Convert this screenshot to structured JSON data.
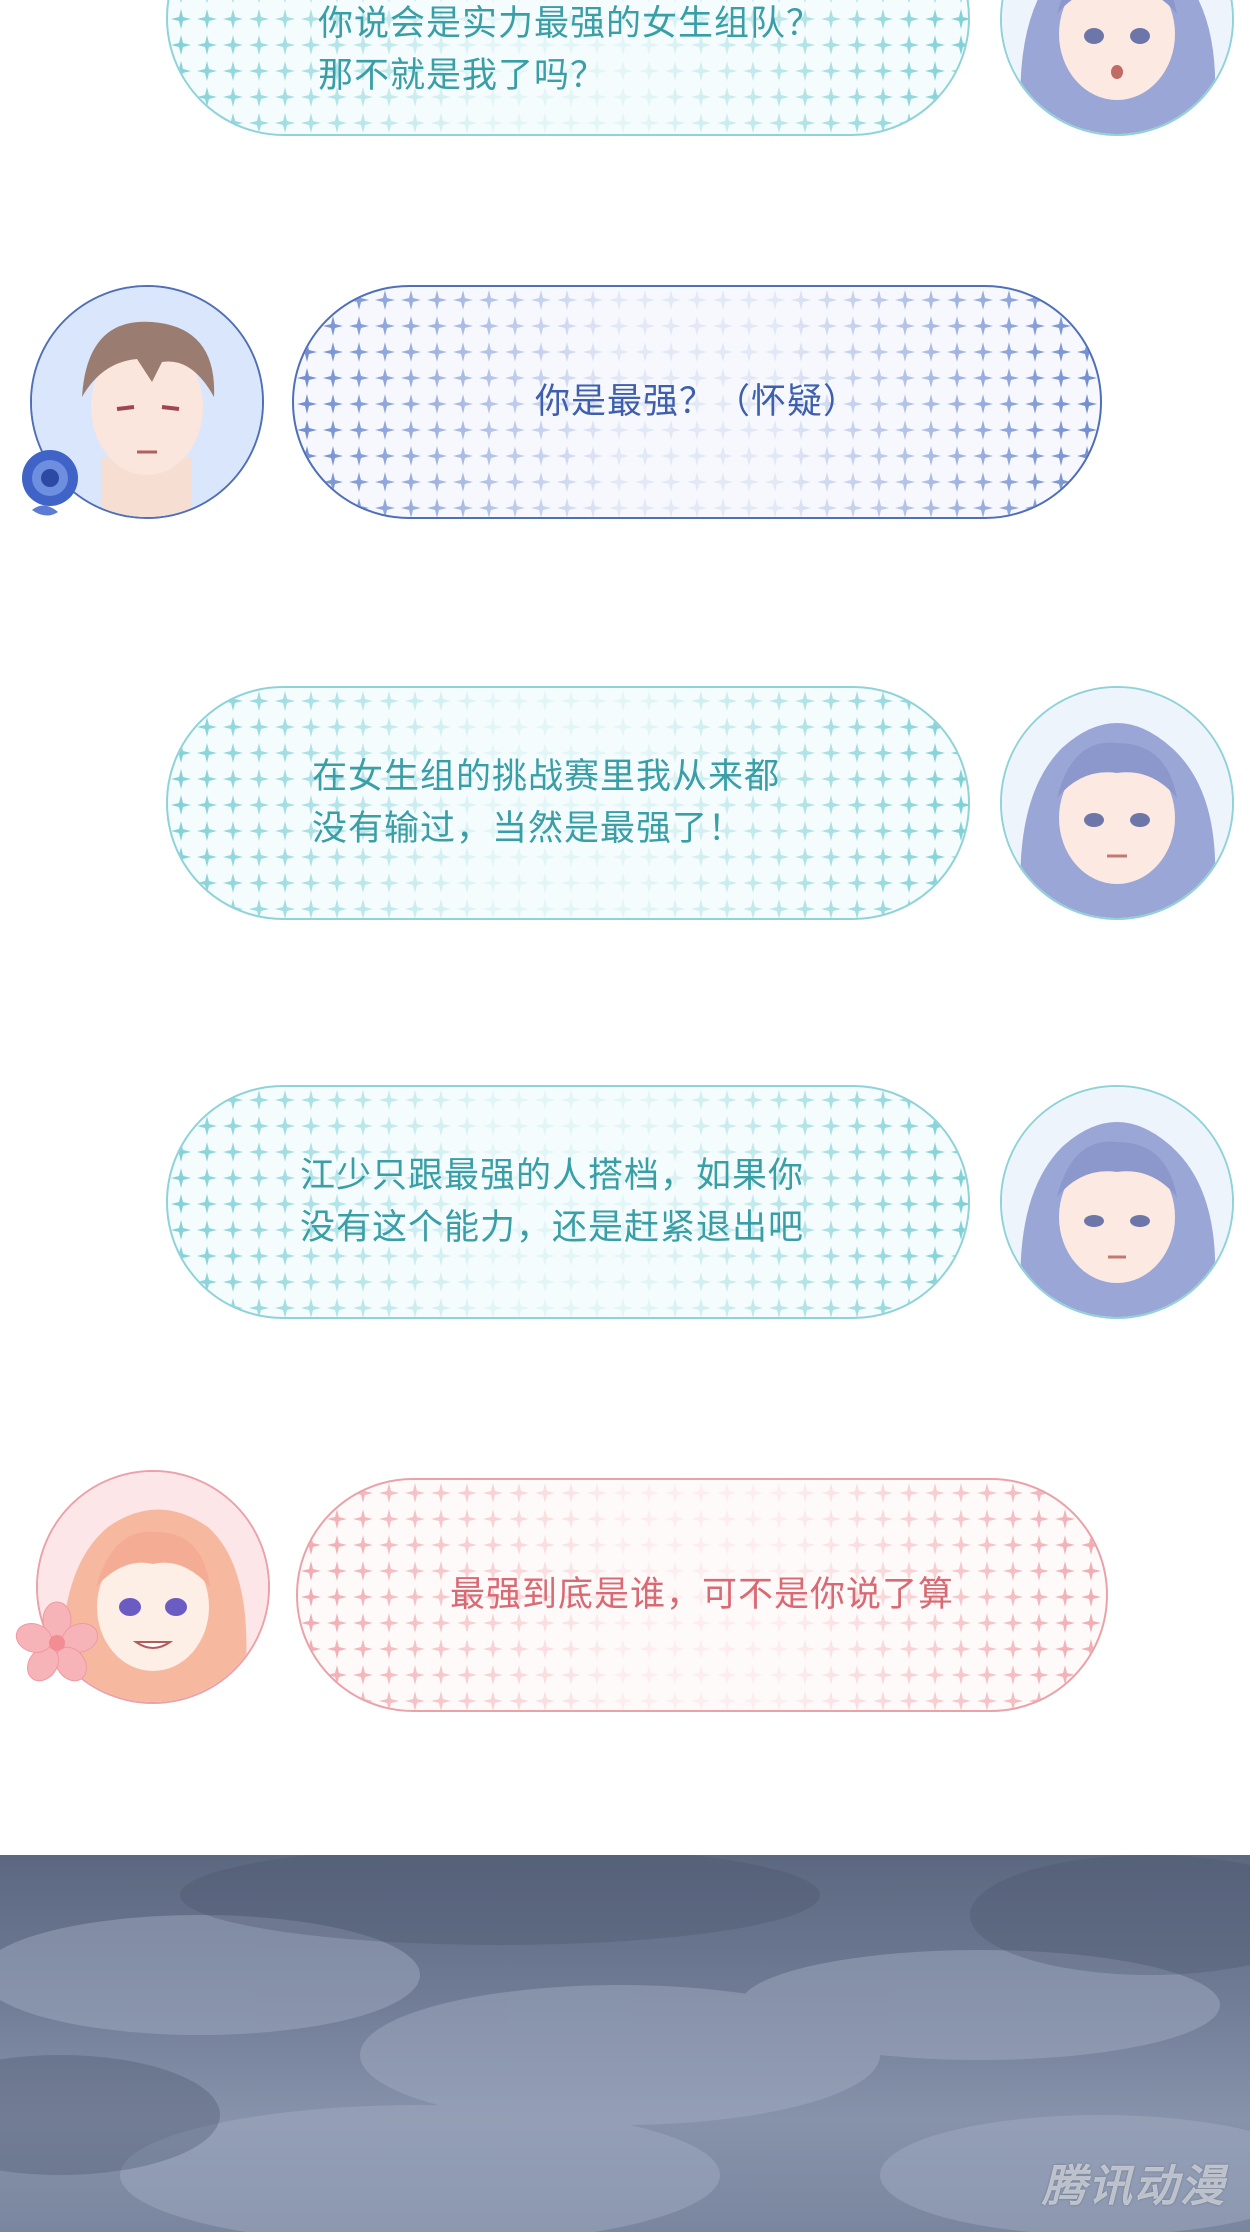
{
  "dialogues": [
    {
      "lines": "你说会是实力最强的女生组队？\n那不就是我了吗？"
    },
    {
      "lines": "你是最强？（怀疑）"
    },
    {
      "lines": "在女生组的挑战赛里我从来都\n没有输过，当然是最强了！"
    },
    {
      "lines": "江少只跟最强的人搭档，如果你\n没有这个能力，还是赶紧退出吧"
    },
    {
      "lines": "最强到底是谁，可不是你说了算"
    }
  ],
  "colors": {
    "teal": "#3a9ea7",
    "blue": "#3d5fad",
    "pink": "#d96a74"
  },
  "watermark": "腾讯动漫"
}
